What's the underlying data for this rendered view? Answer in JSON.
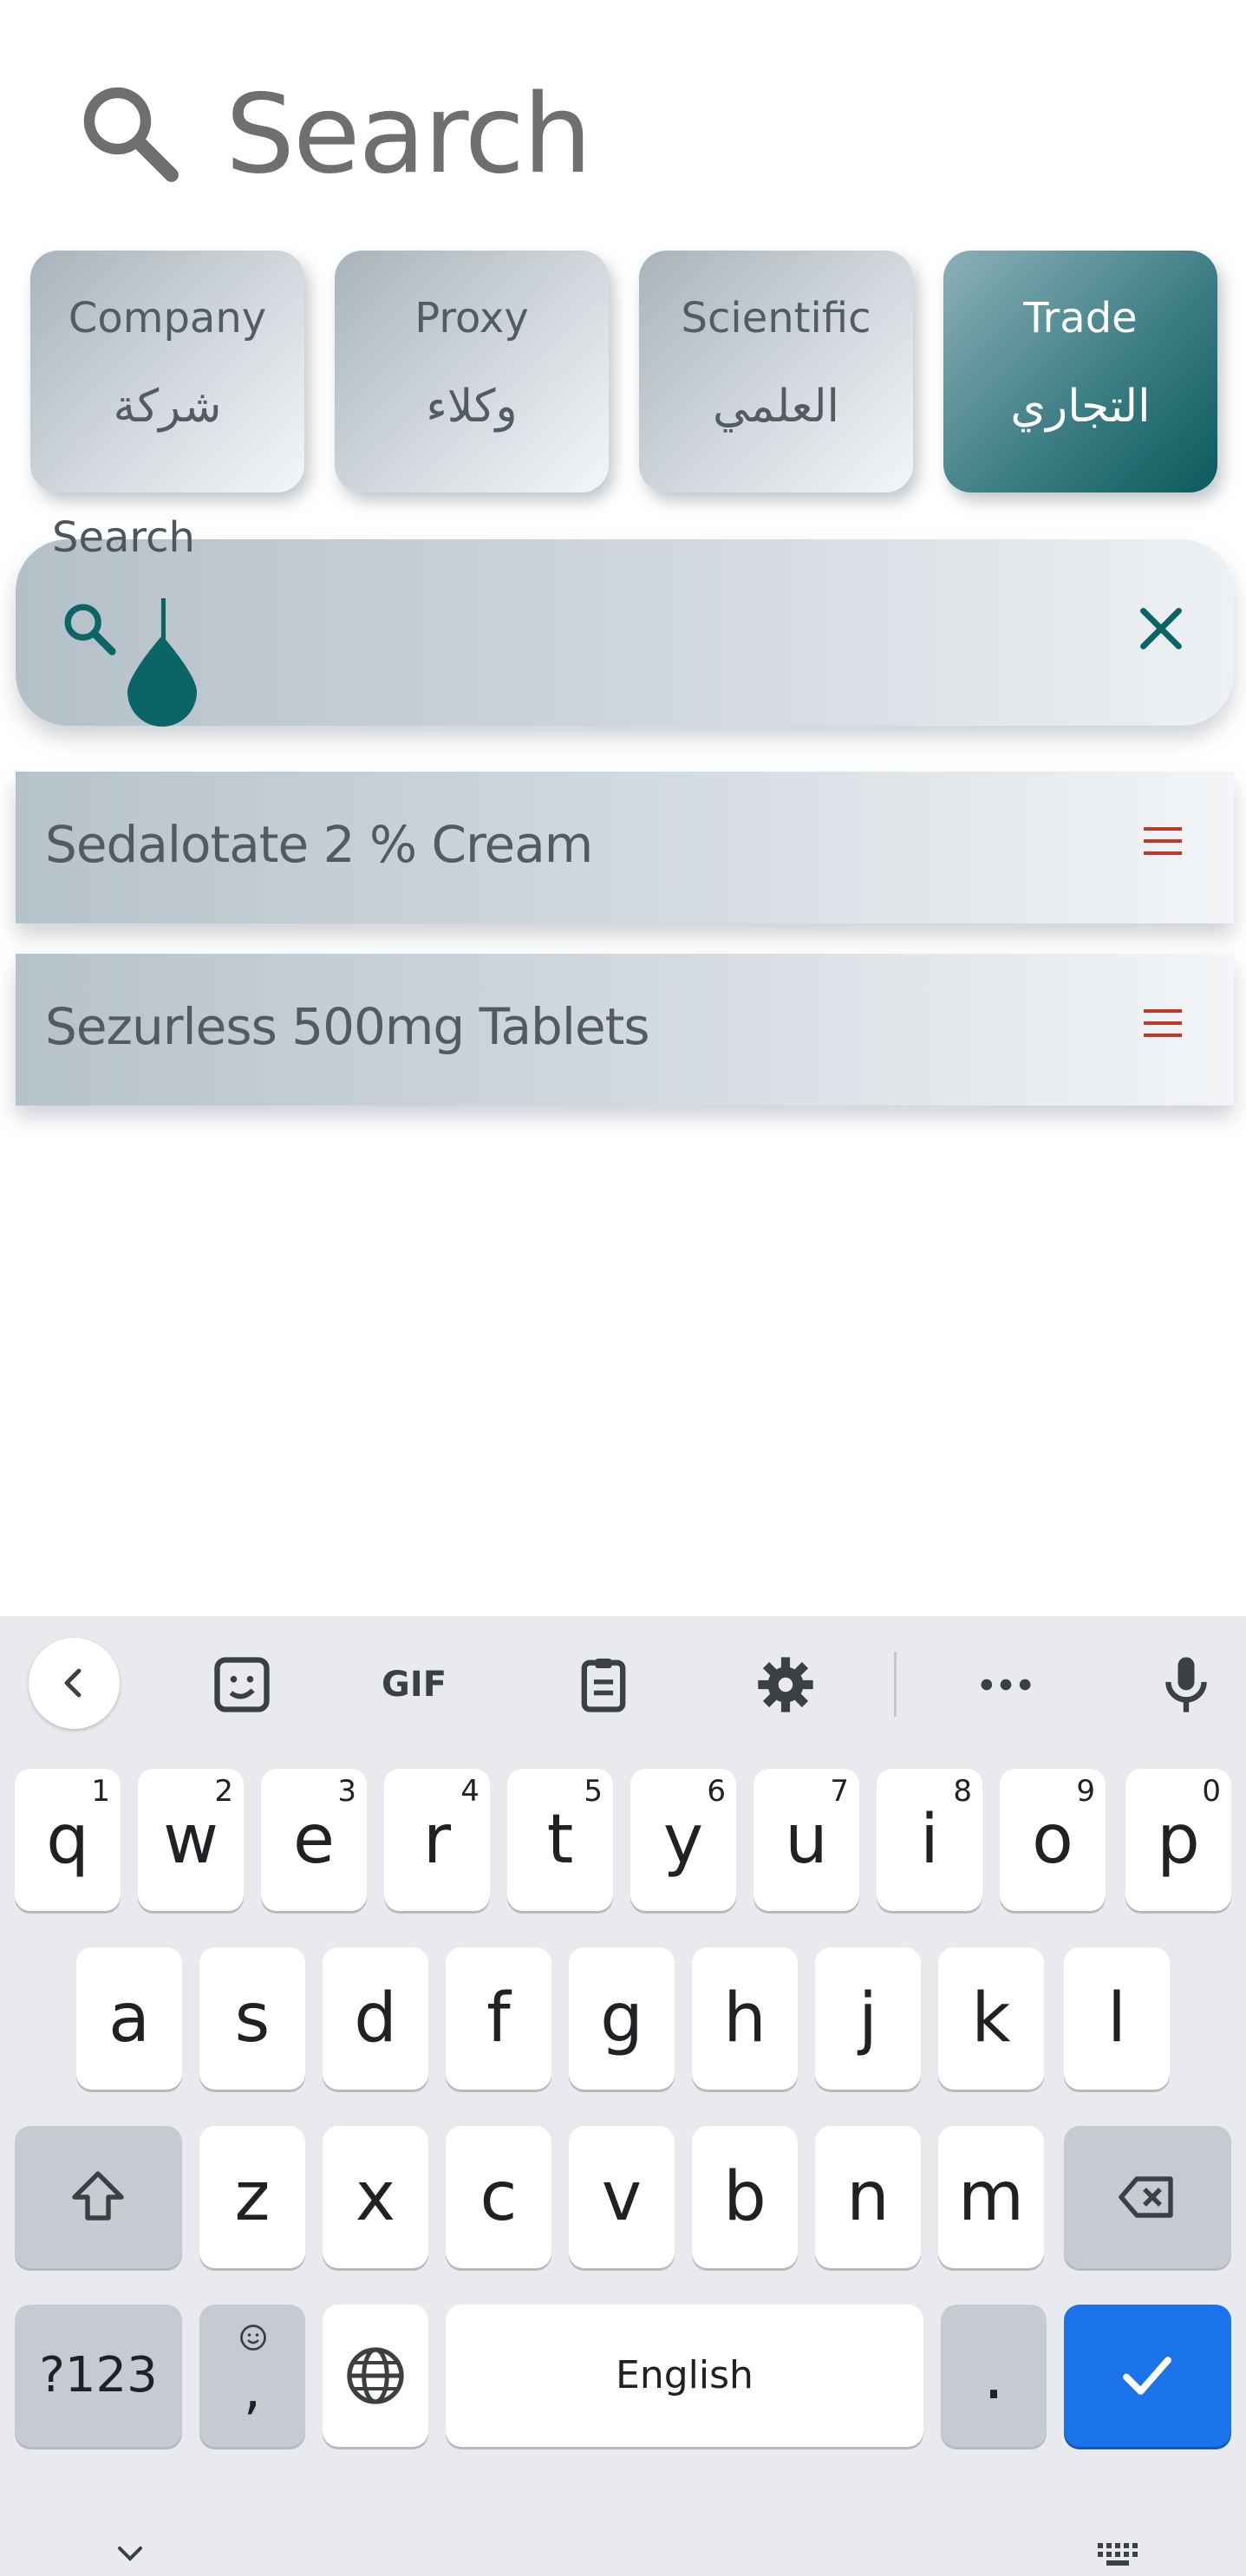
{
  "header": {
    "title": "Search",
    "icon": "search-icon"
  },
  "tabs": [
    {
      "id": "company",
      "en": "Company",
      "ar": "شركة",
      "active": false
    },
    {
      "id": "proxy",
      "en": "Proxy",
      "ar": "وكلاء",
      "active": false
    },
    {
      "id": "scientific",
      "en": "Scientific",
      "ar": "العلمي",
      "active": false
    },
    {
      "id": "trade",
      "en": "Trade",
      "ar": "التجاري",
      "active": true
    }
  ],
  "search": {
    "label": "Search",
    "value": "",
    "icon": "search-icon",
    "clear_icon": "close-icon"
  },
  "results": [
    {
      "name": "Sedalotate 2 % Cream",
      "icon": "menu-lines-icon"
    },
    {
      "name": "Sezurless 500mg Tablets",
      "icon": "menu-lines-icon"
    }
  ],
  "keyboard": {
    "toolbar": [
      "back-chevron-icon",
      "sticker-icon",
      "gif-icon",
      "clipboard-icon",
      "settings-gear-icon",
      "more-dots-icon",
      "microphone-icon"
    ],
    "gif_label": "GIF",
    "row1": [
      {
        "key": "q",
        "hint": "1"
      },
      {
        "key": "w",
        "hint": "2"
      },
      {
        "key": "e",
        "hint": "3"
      },
      {
        "key": "r",
        "hint": "4"
      },
      {
        "key": "t",
        "hint": "5"
      },
      {
        "key": "y",
        "hint": "6"
      },
      {
        "key": "u",
        "hint": "7"
      },
      {
        "key": "i",
        "hint": "8"
      },
      {
        "key": "o",
        "hint": "9"
      },
      {
        "key": "p",
        "hint": "0"
      }
    ],
    "row2": [
      "a",
      "s",
      "d",
      "f",
      "g",
      "h",
      "j",
      "k",
      "l"
    ],
    "row3": [
      "z",
      "x",
      "c",
      "v",
      "b",
      "n",
      "m"
    ],
    "symbols_label": "?123",
    "comma_label": ",",
    "space_label": "English",
    "period_label": ".",
    "accent_color": "#1a73e8"
  },
  "colors": {
    "accent_teal": "#0b6466",
    "menu_red": "#c0392b"
  }
}
